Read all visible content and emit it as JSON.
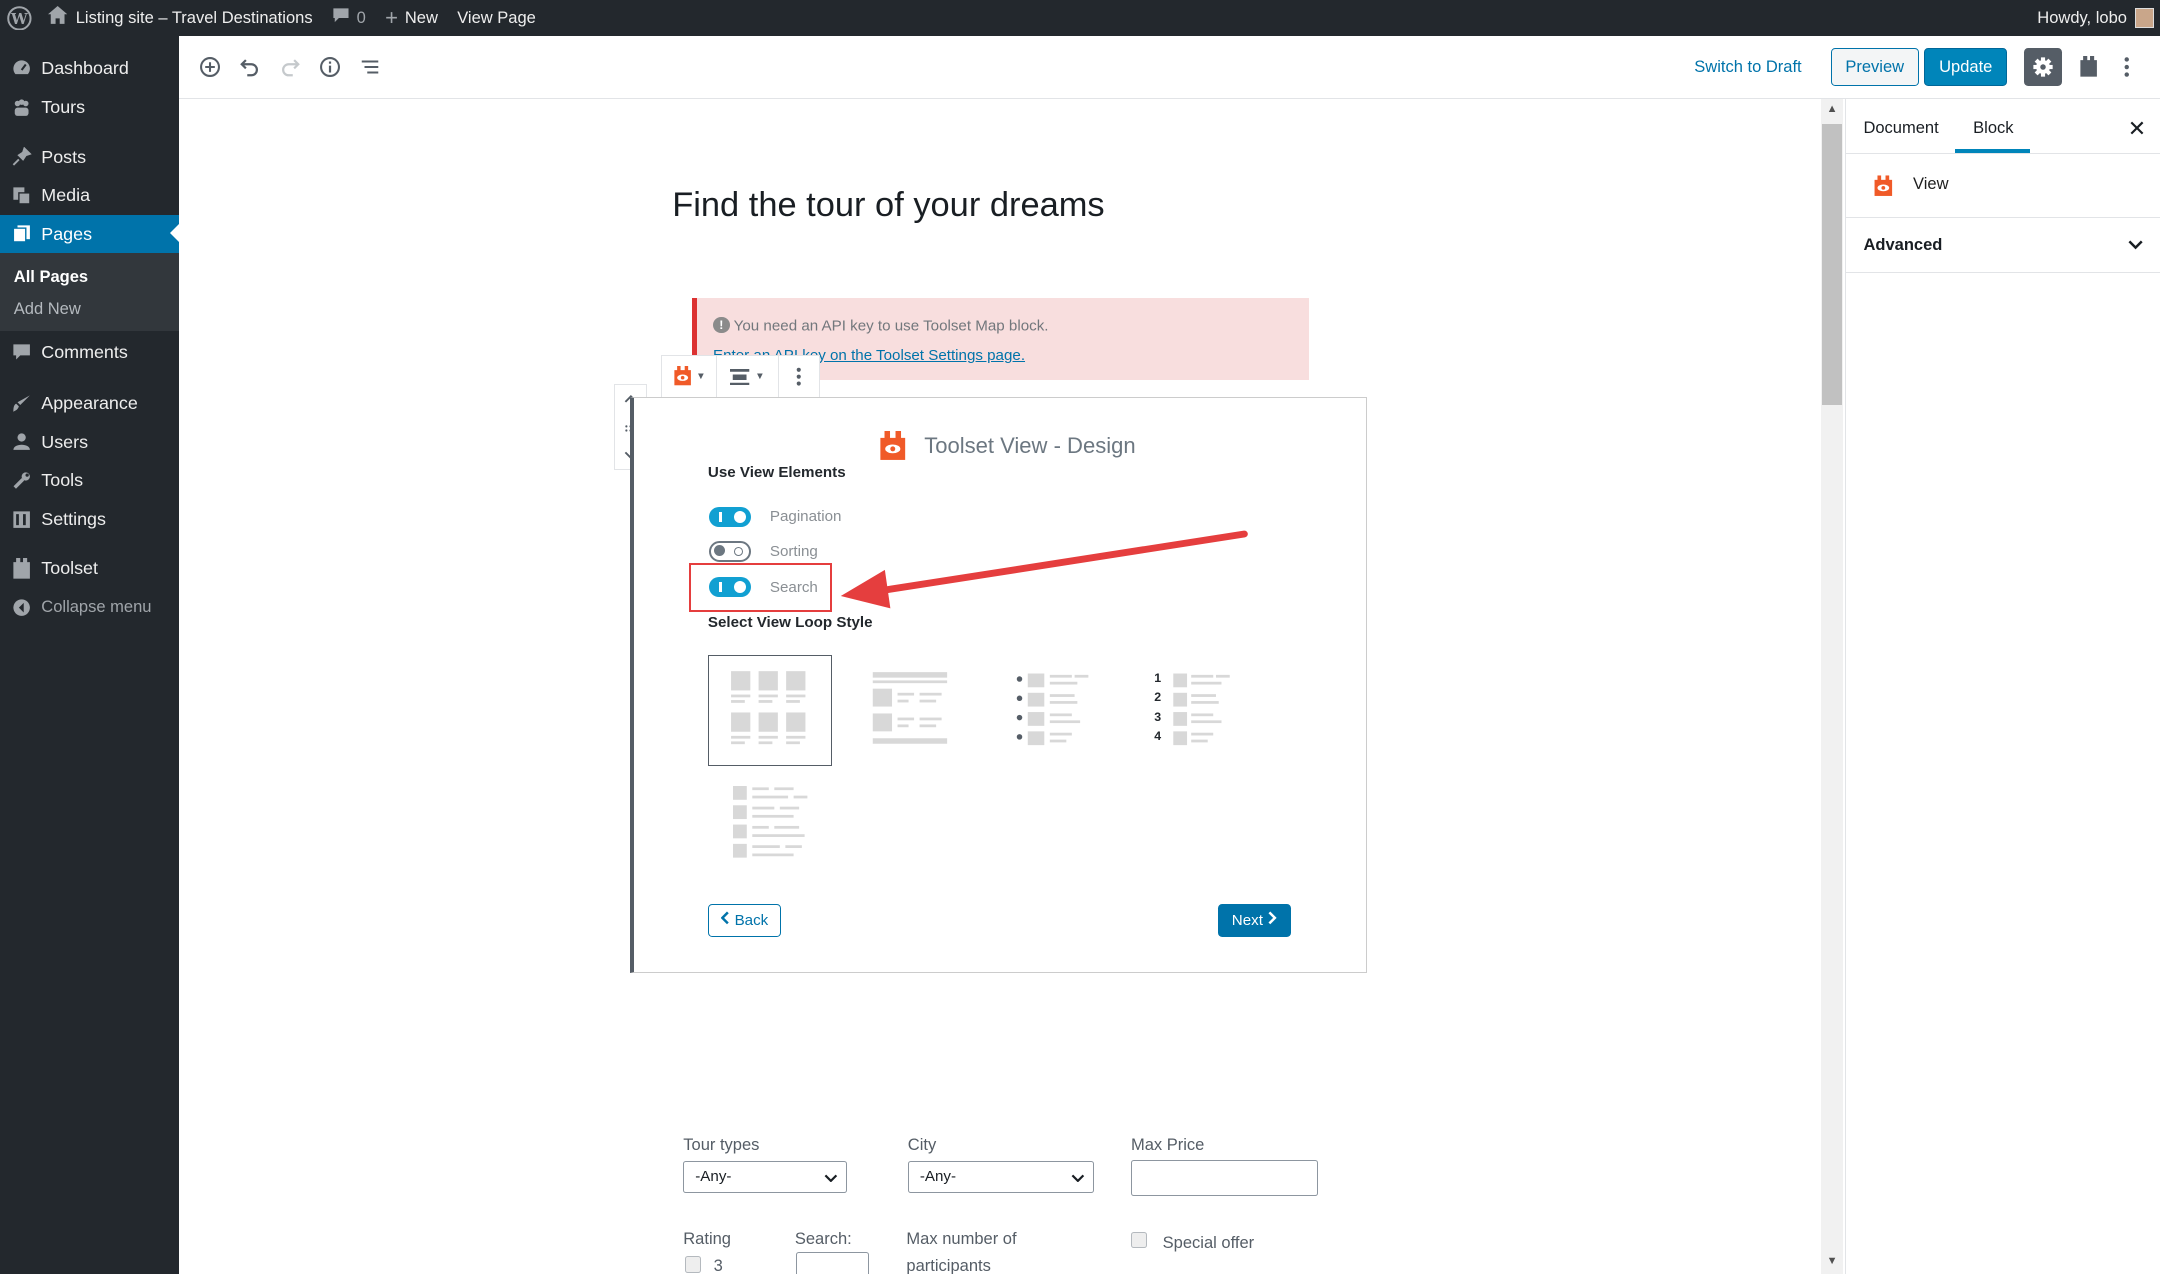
{
  "adminbar": {
    "site_name": "Listing site – Travel Destinations",
    "comments_count": "0",
    "new_label": "New",
    "view_page": "View Page",
    "howdy": "Howdy, lobo"
  },
  "sidebar": {
    "items": [
      {
        "label": "Dashboard",
        "icon": "dashboard-icon"
      },
      {
        "label": "Tours",
        "icon": "tours-icon"
      },
      {
        "label": "Posts",
        "icon": "pin-icon"
      },
      {
        "label": "Media",
        "icon": "media-icon"
      },
      {
        "label": "Pages",
        "icon": "pages-icon"
      },
      {
        "label": "Comments",
        "icon": "comment-icon"
      },
      {
        "label": "Appearance",
        "icon": "brush-icon"
      },
      {
        "label": "Users",
        "icon": "user-icon"
      },
      {
        "label": "Tools",
        "icon": "wrench-icon"
      },
      {
        "label": "Settings",
        "icon": "settings-icon"
      },
      {
        "label": "Toolset",
        "icon": "toolset-icon"
      }
    ],
    "submenu": [
      "All Pages",
      "Add New"
    ],
    "collapse": "Collapse menu"
  },
  "header": {
    "switch_to_draft": "Switch to Draft",
    "preview": "Preview",
    "update": "Update"
  },
  "panel": {
    "tab_document": "Document",
    "tab_block": "Block",
    "block_name": "View",
    "advanced": "Advanced"
  },
  "content": {
    "title": "Find the tour of your dreams",
    "notice_line1": "You need an API key to use Toolset Map block.",
    "notice_line2": "Enter an API key on the Toolset Settings page.",
    "view_title": "Toolset View - Design",
    "use_view_elements": "Use View Elements",
    "toggles": [
      {
        "label": "Pagination",
        "on": true
      },
      {
        "label": "Sorting",
        "on": false
      },
      {
        "label": "Search",
        "on": true
      }
    ],
    "select_loop_style": "Select View Loop Style",
    "loop_styles": [
      "grid",
      "list-with-images",
      "bulleted-list",
      "numbered-list",
      "table"
    ],
    "numbered": [
      "1",
      "2",
      "3",
      "4"
    ],
    "back": "Back",
    "next": "Next"
  },
  "form": {
    "tour_types_label": "Tour types",
    "tour_types_value": "-Any-",
    "city_label": "City",
    "city_value": "-Any-",
    "max_price_label": "Max Price",
    "rating_label": "Rating",
    "rating_option": "3",
    "search_label": "Search:",
    "max_participants_label_1": "Max number of",
    "max_participants_label_2": "participants",
    "special_offer": "Special offer"
  },
  "colors": {
    "admin_dark": "#23282d",
    "wp_blue": "#0073aa",
    "toggle_blue": "#11a0d2",
    "toolset_orange": "#f05a28",
    "highlight_red": "#e53e3e"
  }
}
